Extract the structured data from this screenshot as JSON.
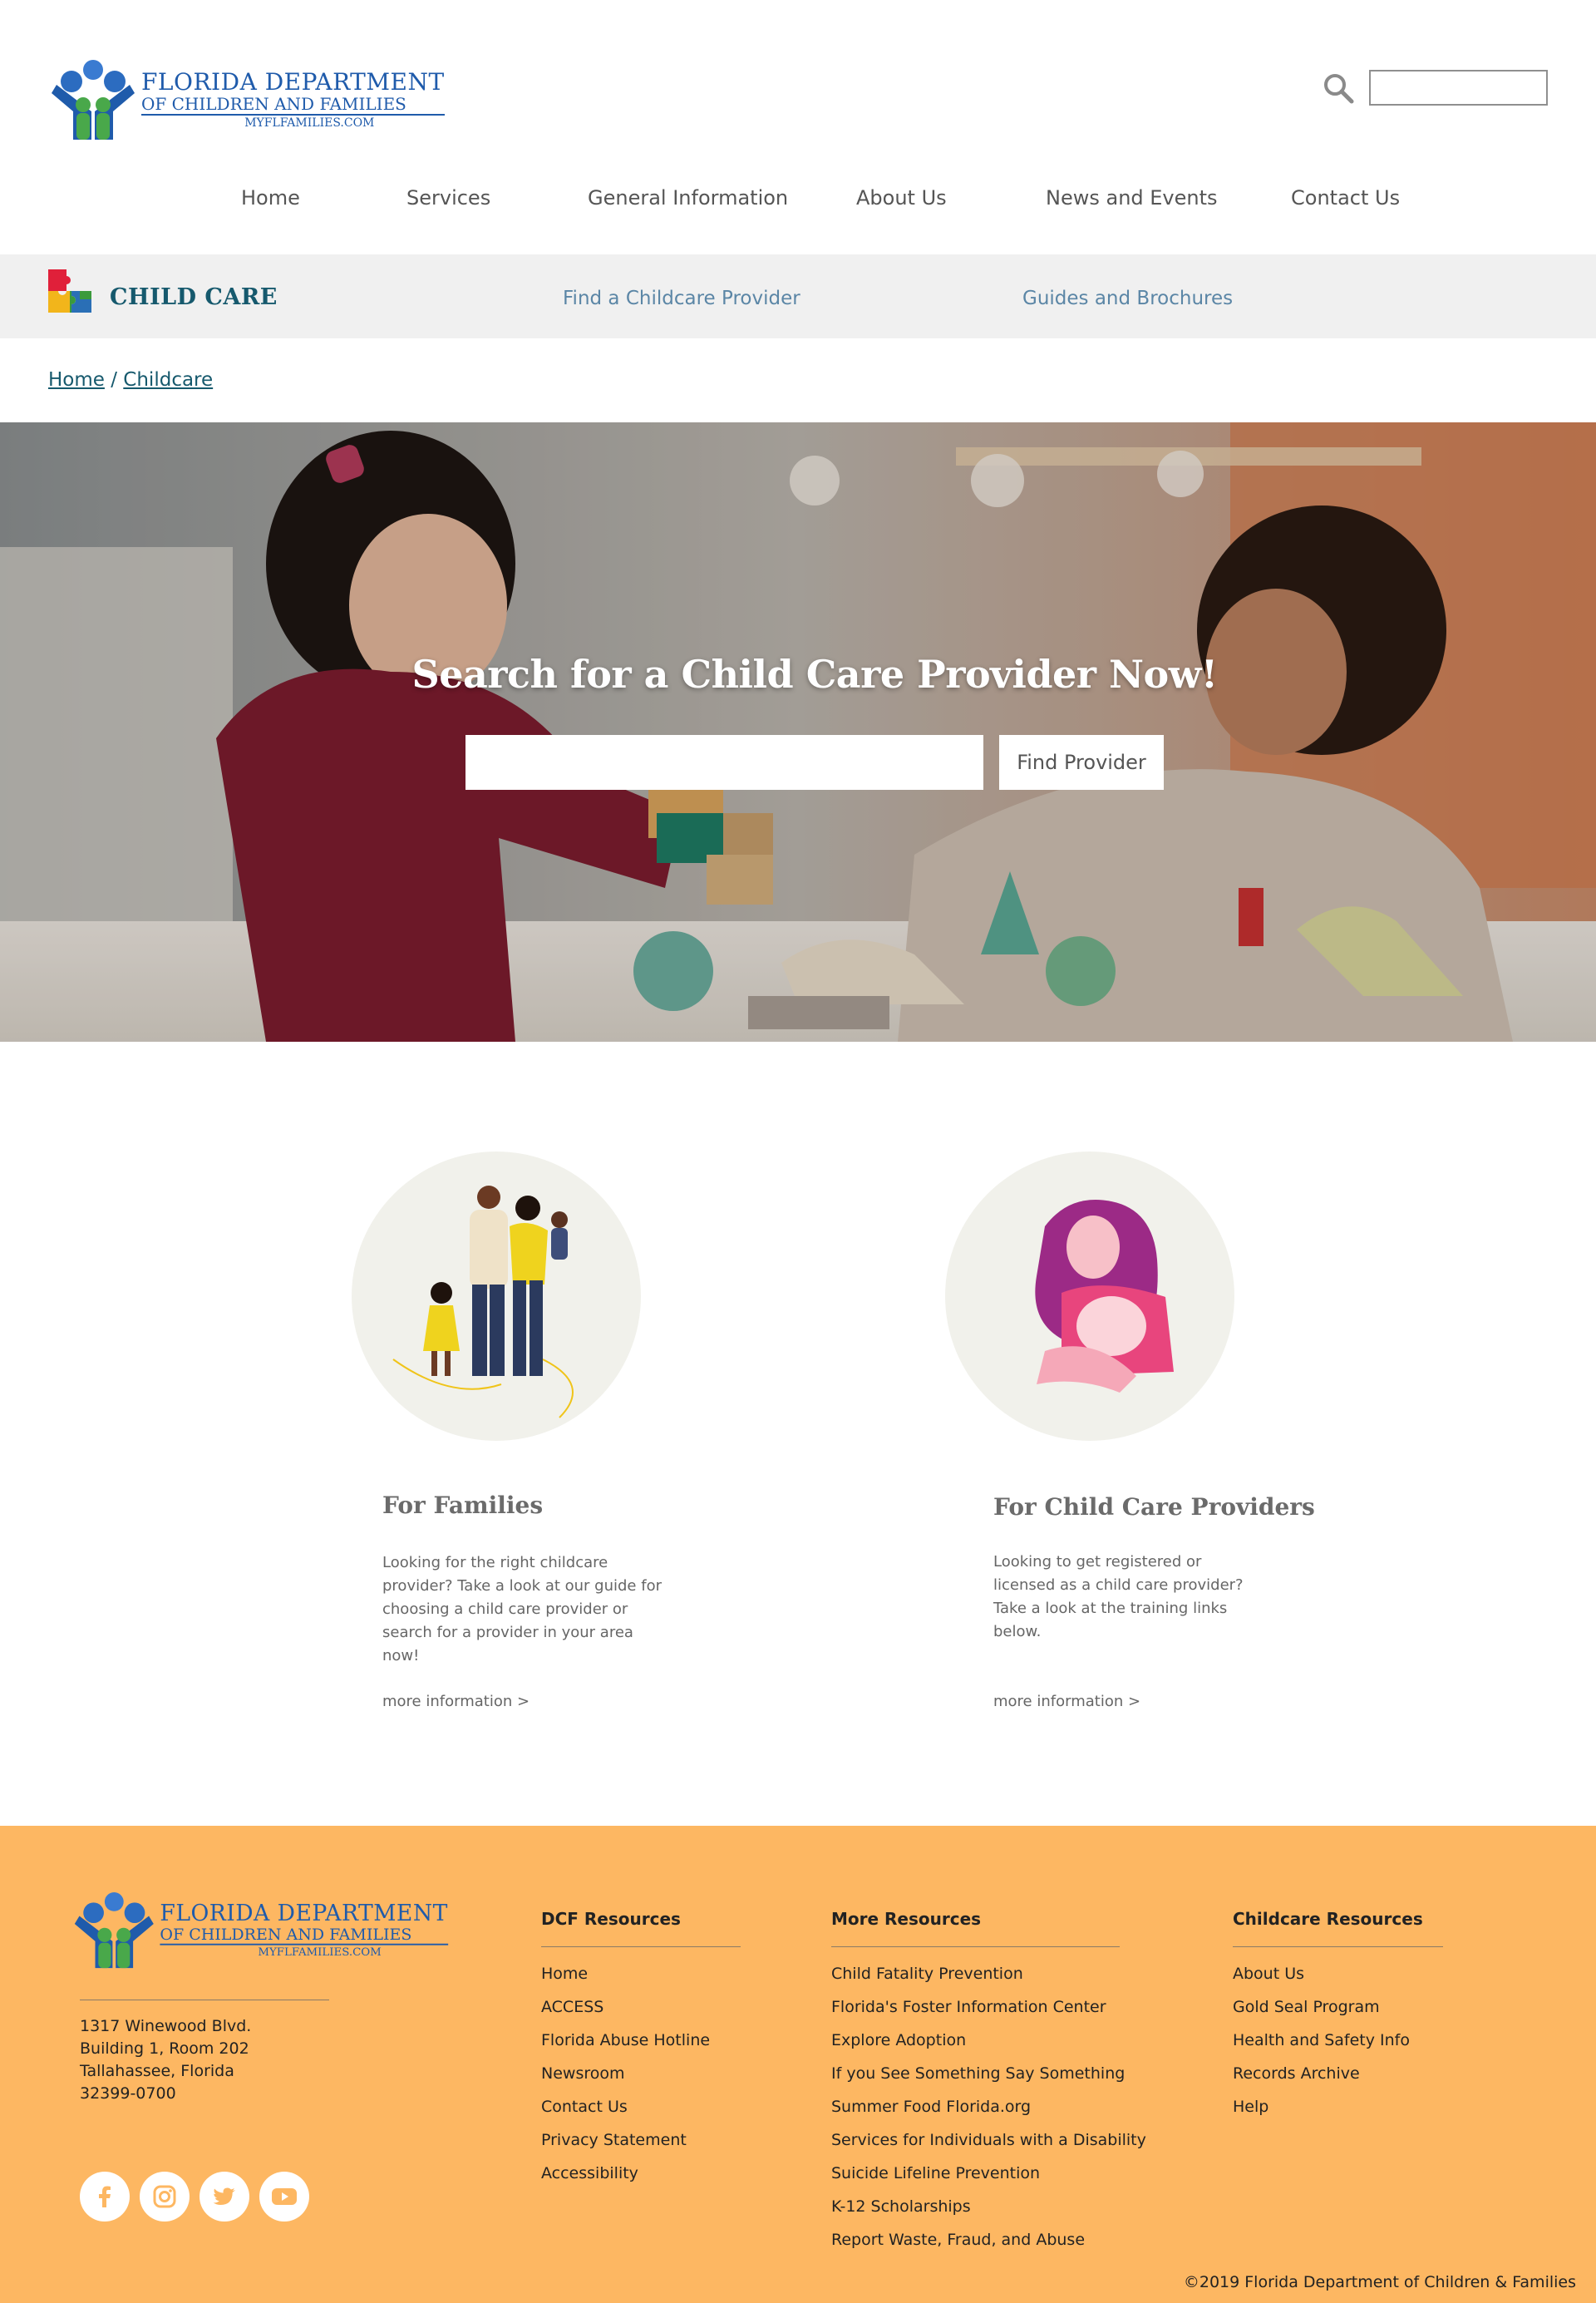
{
  "header": {
    "logo": {
      "line1": "FLORIDA DEPARTMENT",
      "line2": "OF CHILDREN AND FAMILIES",
      "line3": "MYFLFAMILIES.COM"
    },
    "search": {
      "value": "",
      "placeholder": ""
    }
  },
  "nav": {
    "items": [
      "Home",
      "Services",
      "General Information",
      "About Us",
      "News and Events",
      "Contact Us"
    ]
  },
  "subnav": {
    "title": "CHILD CARE",
    "links": [
      "Find a Childcare Provider",
      "Guides and Brochures"
    ]
  },
  "breadcrumb": {
    "home": "Home",
    "separator": "/",
    "current": "Childcare"
  },
  "hero": {
    "heading": "Search for a Child Care Provider Now!",
    "input_value": "",
    "button_label": "Find Provider"
  },
  "cards": [
    {
      "title": "For Families",
      "text": "Looking for the right childcare provider? Take a look at our guide for choosing a child care provider or search for a provider in your area now!",
      "link": "more information >"
    },
    {
      "title": "For Child Care Providers",
      "text": "Looking to get registered or licensed as a child care provider? Take a look at the training links below.",
      "link": "more information >"
    }
  ],
  "footer": {
    "address": [
      "1317 Winewood Blvd.",
      "Building 1, Room 202",
      "Tallahassee, Florida",
      "32399-0700"
    ],
    "columns": [
      {
        "heading": "DCF Resources",
        "links": [
          "Home",
          "ACCESS",
          "Florida Abuse Hotline",
          "Newsroom",
          "Contact Us",
          "Privacy Statement",
          "Accessibility"
        ]
      },
      {
        "heading": "More Resources",
        "links": [
          "Child Fatality Prevention",
          "Florida's Foster Information Center",
          "Explore Adoption",
          "If you See Something Say Something",
          "Summer Food Florida.org",
          "Services for Individuals with a Disability",
          "Suicide Lifeline Prevention",
          "K-12 Scholarships",
          "Report Waste, Fraud, and Abuse"
        ]
      },
      {
        "heading": "Childcare Resources",
        "links": [
          "About Us",
          "Gold Seal Program",
          "Health and Safety Info",
          "Records Archive",
          "Help"
        ]
      }
    ],
    "social": [
      "facebook-icon",
      "instagram-icon",
      "twitter-icon",
      "youtube-icon"
    ],
    "copyright": "©2019 Florida Department of Children & Families"
  },
  "colors": {
    "footer_bg": "#fdb762",
    "logo_blue": "#1f5bab",
    "subnav_title": "#16596d",
    "subnav_link": "#5b86a6"
  }
}
